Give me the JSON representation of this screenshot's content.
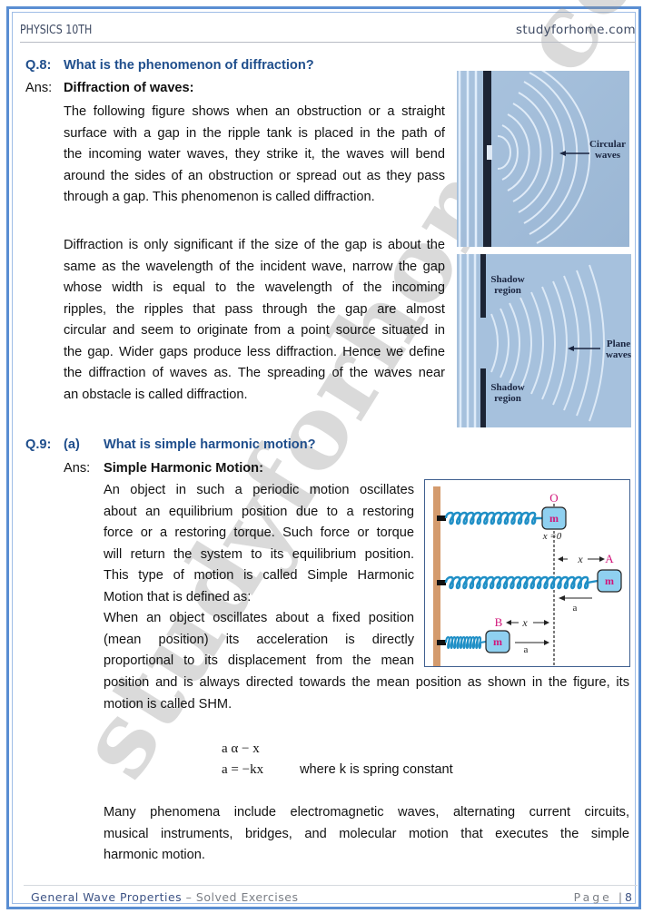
{
  "header": {
    "left": "PHYSICS 10TH",
    "right": "studyforhome.com"
  },
  "watermark": "studyforhome.com",
  "q8": {
    "label": "Q.8:",
    "question": "What is the phenomenon of diffraction?",
    "ans_label": "Ans:",
    "heading": "Diffraction of waves:",
    "para1_lines": [
      "The following figure shows when an obstruction or a straight",
      "surface with a gap in the ripple tank is placed in the path of",
      "the incoming water waves, they strike it, the waves will bend",
      "around the sides of an obstruction or spread out as they pass",
      "through a gap. This phenomenon is called diffraction."
    ],
    "para2_lines": [
      "Diffraction is only significant if the size of the gap is about the",
      "same as the wavelength of the incident wave, narrow the gap",
      "whose width is equal to the wavelength of the incoming",
      "ripples, the ripples that pass through the gap are almost",
      "circular and seem to originate from a point source situated in",
      "the gap. Wider gaps produce less diffraction. Hence we define",
      "the diffraction of waves as. The spreading of the waves near",
      "an obstacle is called diffraction."
    ],
    "figure_top": {
      "label_line1": "Circular",
      "label_line2": "waves"
    },
    "figure_bottom": {
      "shadow_top_line1": "Shadow",
      "shadow_top_line2": "region",
      "plane_line1": "Plane",
      "plane_line2": "waves",
      "shadow_bottom_line1": "Shadow",
      "shadow_bottom_line2": "region"
    }
  },
  "q9": {
    "label": "Q.9:",
    "part": "(a)",
    "question": "What is simple harmonic motion?",
    "ans_label": "Ans:",
    "heading": "Simple Harmonic Motion:",
    "narrow_lines": [
      "An object in such a periodic motion oscillates",
      "about an equilibrium position due to a restoring",
      "force or a restoring torque. Such force or torque",
      "will return the system to its equilibrium position.",
      "This type of motion is called Simple Harmonic",
      "Motion that is defined as:",
      "When an object oscillates about a fixed position",
      "(mean position) its acceleration is directly",
      "proportional to its displacement from the mean"
    ],
    "wide_lines": [
      "position and is always directed towards the mean position as shown in the figure, its",
      "motion is called SHM."
    ],
    "eq1": "a α − x",
    "eq2": "a =  −kx",
    "eq2_note": "where k is spring constant",
    "para_lines": [
      "Many phenomena include electromagnetic waves, alternating current circuits,",
      "musical instruments, bridges, and molecular motion that executes the simple",
      "harmonic motion."
    ],
    "figure": {
      "label_O": "O",
      "label_x0": "x =0",
      "label_x_A": "x",
      "label_A": "A",
      "label_a_A": "a",
      "label_B": "B",
      "label_x_B": "x",
      "label_a_B": "a",
      "mass": "m",
      "colors": {
        "spring": "#1f8fc6",
        "mass_fill": "#8fd0f0",
        "mass_label": "#d1157a",
        "point_label": "#d1157a",
        "wall": "#d49b6d"
      }
    }
  },
  "footer": {
    "title": "General Wave Properties",
    "separator": " – ",
    "subtitle": "Solved Exercises",
    "page_label": "Page |",
    "page_number": "8"
  }
}
